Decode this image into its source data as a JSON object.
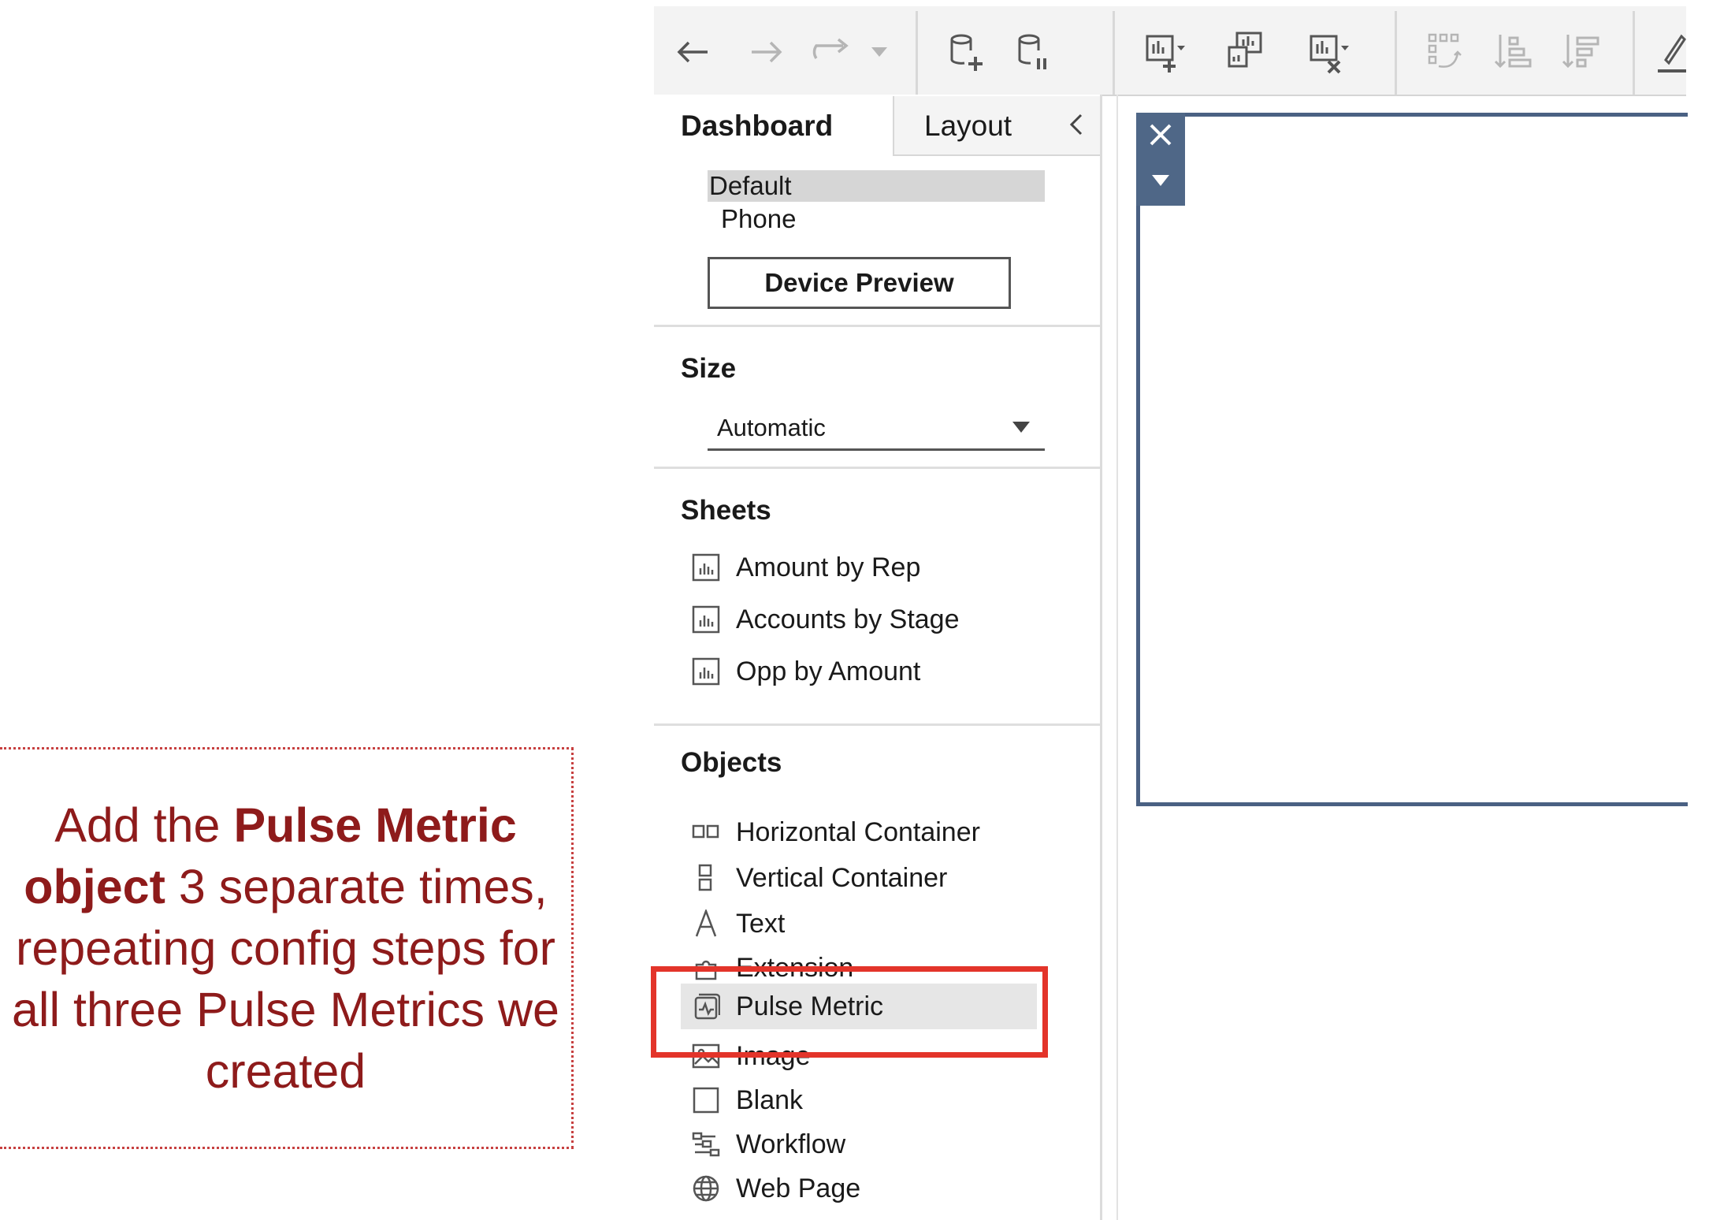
{
  "callout": {
    "part1": "Add the ",
    "bold": "Pulse Metric object",
    "part2": " 3 separate times, repeating config steps for all three Pulse Metrics we created",
    "color": "#8e1b1b"
  },
  "toolbar": {
    "icons": [
      "back-arrow-icon",
      "forward-arrow-icon",
      "redo-icon",
      "dropdown-icon",
      "new-data-source-icon",
      "pause-data-source-icon",
      "new-worksheet-icon",
      "new-dashboard-icon",
      "clear-sheet-icon",
      "swap-icon",
      "sort-ascending-icon",
      "sort-descending-icon",
      "highlight-icon"
    ]
  },
  "panel": {
    "tab_dashboard": "Dashboard",
    "tab_layout": "Layout",
    "device_options": [
      "Default",
      "Phone"
    ],
    "device_preview": "Device Preview",
    "size_title": "Size",
    "size_value": "Automatic",
    "sheets_title": "Sheets",
    "sheets": [
      "Amount by Rep",
      "Accounts by Stage",
      "Opp by Amount"
    ],
    "objects_title": "Objects",
    "objects": [
      "Horizontal Container",
      "Vertical Container",
      "Text",
      "Extension",
      "Pulse Metric",
      "Image",
      "Blank",
      "Workflow",
      "Web Page"
    ]
  },
  "colors": {
    "highlight_border": "#e3342a",
    "canvas_border": "#4a6183"
  }
}
